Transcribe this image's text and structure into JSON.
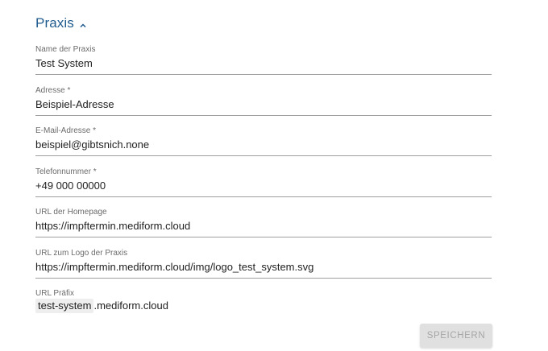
{
  "section": {
    "title": "Praxis",
    "toggle_icon": "chevron-up-icon",
    "accent_color": "#1f5b8f"
  },
  "fields": [
    {
      "label": "Name der Praxis",
      "value": "Test System"
    },
    {
      "label": "Adresse *",
      "value": "Beispiel-Adresse"
    },
    {
      "label": "E-Mail-Adresse *",
      "value": "beispiel@gibtsnich.none"
    },
    {
      "label": "Telefonnummer *",
      "value": "+49 000 00000"
    },
    {
      "label": "URL der Homepage",
      "value": "https://impftermin.mediform.cloud"
    },
    {
      "label": "URL zum Logo der Praxis",
      "value": "https://impftermin.mediform.cloud/img/logo_test_system.svg"
    }
  ],
  "url_prefix": {
    "label": "URL Präfix",
    "value": "test-system",
    "suffix": ".mediform.cloud"
  },
  "actions": {
    "save_label": "SPEICHERN"
  }
}
